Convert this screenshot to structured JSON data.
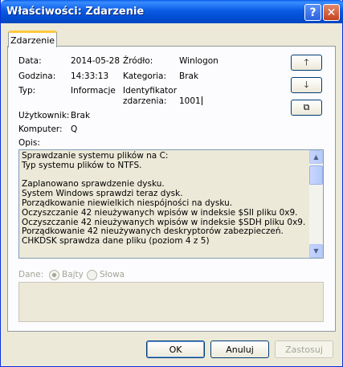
{
  "window": {
    "title": "Właściwości: Zdarzenie",
    "help_glyph": "?",
    "close_glyph": "✕"
  },
  "tabs": [
    {
      "label": "Zdarzenie"
    }
  ],
  "event": {
    "date_label": "Data:",
    "date_value": "2014-05-28",
    "source_label": "Źródło:",
    "source_value": "Winlogon",
    "time_label": "Godzina:",
    "time_value": "14:33:13",
    "category_label": "Kategoria:",
    "category_value": "Brak",
    "type_label": "Typ:",
    "type_value": "Informacje",
    "id_label_line1": "Identyfikator",
    "id_label_line2": "zdarzenia:",
    "id_value": "1001",
    "user_label": "Użytkownik:",
    "user_value": "Brak",
    "computer_label": "Komputer:",
    "computer_value": "Q",
    "description_label": "Opis:"
  },
  "nav": {
    "up_glyph": "🡑",
    "down_glyph": "🡓",
    "copy_glyph": "⧉"
  },
  "description_lines": [
    "Sprawdzanie systemu plików na C:",
    "Typ systemu plików to NTFS.",
    "",
    "Zaplanowano sprawdzenie dysku.",
    "System Windows sprawdzi teraz dysk.",
    "Porządkowanie niewielkich niespójności na dysku.",
    "Oczyszczanie 42 nieużywanych wpisów w indeksie $SII pliku 0x9.",
    "Oczyszczanie 42 nieużywanych wpisów w indeksie $SDH pliku 0x9.",
    "Porządkowanie 42 nieużywanych deskryptorów zabezpieczeń.",
    "CHKDSK sprawdza dane pliku (poziom 4 z 5)"
  ],
  "data_section": {
    "label": "Dane:",
    "option_bytes": "Bajty",
    "option_words": "Słowa",
    "selected": "Bajty"
  },
  "buttons": {
    "ok": "OK",
    "cancel": "Anuluj",
    "apply": "Zastosuj"
  },
  "colors": {
    "titlebar": "#0350d6",
    "window_bg": "#ece9d8",
    "tab_accent": "#ffc83c",
    "disabled_text": "#a4a497"
  }
}
